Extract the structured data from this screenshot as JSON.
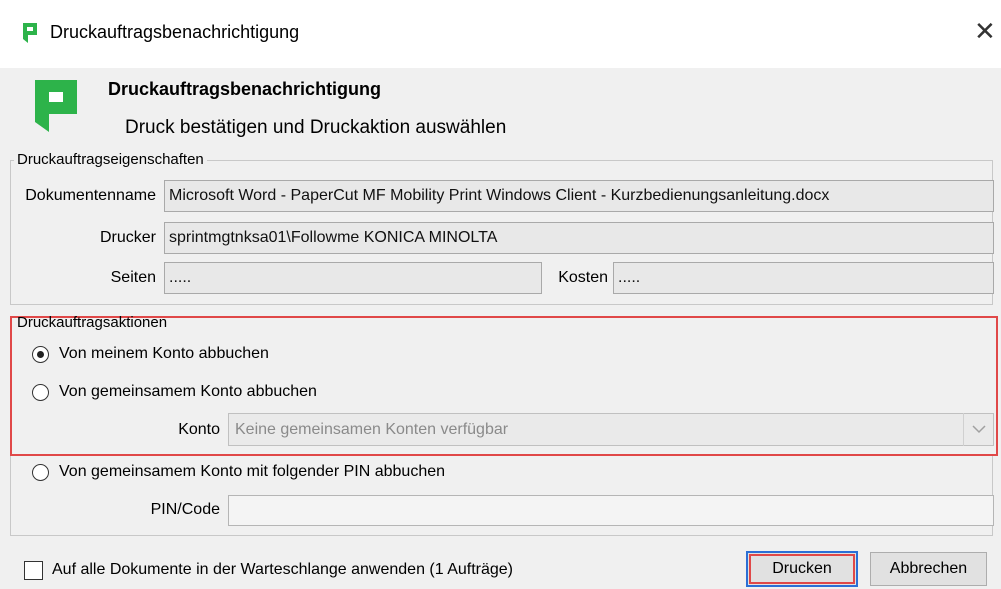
{
  "window": {
    "title": "Druckauftragsbenachrichtigung"
  },
  "header": {
    "title": "Druckauftragsbenachrichtigung",
    "subtitle": "Druck bestätigen und Druckaktion auswählen"
  },
  "properties": {
    "legend": "Druckauftragseigenschaften",
    "document_label": "Dokumentenname",
    "document_value": "Microsoft Word - PaperCut MF Mobility Print Windows Client - Kurzbedienungsanleitung.docx",
    "printer_label": "Drucker",
    "printer_value": "sprintmgtnksa01\\Followme KONICA MINOLTA",
    "pages_label": "Seiten",
    "pages_value": ".....",
    "cost_label": "Kosten",
    "cost_value": "....."
  },
  "actions": {
    "legend": "Druckauftragsaktionen",
    "option_own": "Von meinem Konto abbuchen",
    "option_shared": "Von gemeinsamem Konto abbuchen",
    "account_label": "Konto",
    "account_value": "Keine gemeinsamen Konten verfügbar",
    "option_pin": "Von gemeinsamem Konto mit folgender PIN abbuchen",
    "pin_label": "PIN/Code",
    "pin_value": "",
    "selected": "option_own"
  },
  "footer": {
    "apply_all_label": "Auf alle Dokumente in der Warteschlange anwenden (1 Aufträge)",
    "apply_all_checked": false,
    "print_button": "Drucken",
    "cancel_button": "Abbrechen"
  },
  "colors": {
    "brand_green": "#2db34a",
    "highlight_red": "#e04848",
    "focus_blue": "#2b6fd6"
  }
}
